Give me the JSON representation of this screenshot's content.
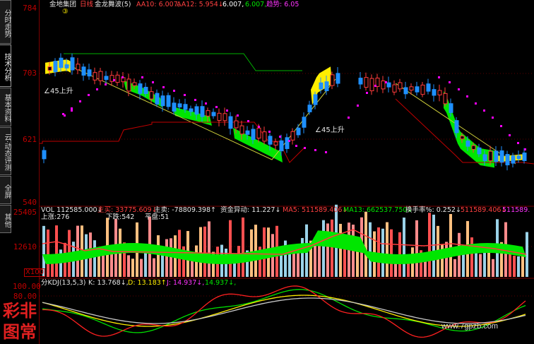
{
  "sidebar": {
    "tabs": [
      {
        "label": "分时走势",
        "active": false
      },
      {
        "label": "技术分析",
        "active": true
      },
      {
        "label": "基本资料",
        "active": false
      },
      {
        "label": "云·动态评测",
        "active": false
      },
      {
        "label": "全屏",
        "active": false
      },
      {
        "label": "其他",
        "active": false
      }
    ]
  },
  "main_chart": {
    "title": "金地集团",
    "period": "日线",
    "indicator": "金龙舞波(5)",
    "circle_num": "③",
    "aa10": "AA10: 6.007,",
    "aa12": "AA12: 5.954↓",
    "val3": "6.007,",
    "val4": "6.007,",
    "trend": "趋势: 6.05",
    "y_ticks": [
      "784",
      "703",
      "621",
      "540"
    ],
    "annotation_1": "∠45上升",
    "annotation_2": "∠45上升"
  },
  "volume_panel": {
    "vol": "VOL 112585.000↓",
    "main_buy": "主买: 33775.609↓",
    "main_sell": "主卖: -78809.398↑",
    "fund_anomaly": "资金异动: 11.227↓",
    "ma5": "MA5: 511589.406↓",
    "ma13": "MA13: 662537.750↓",
    "turnover": "换手率%: 0.252↓",
    "extra1": "511589.406↓",
    "extra2": "511589.",
    "up": "上涨:276",
    "down": "下跌:542",
    "flat": "平盘:51",
    "y_ticks": [
      "25405",
      "12610"
    ],
    "unit": "X100"
  },
  "kdj_panel": {
    "name": "分KDJ(13,5,3)",
    "k": "K: 13.768↓,",
    "d": "D: 13.183↑,",
    "j": "J: 14.937↓,",
    "j2": "14.937↓,",
    "y_ticks": [
      "100.00",
      "80.00"
    ]
  },
  "watermark": "www.7gpzb.com",
  "logo_text": "彩图\n非常",
  "colors": {
    "up": "#ff3c3c",
    "down": "#1e90ff",
    "green_band": "#00e600",
    "yellow_band": "#ffee00",
    "dots": "#ff00ff",
    "grid": "#7a0000"
  }
}
